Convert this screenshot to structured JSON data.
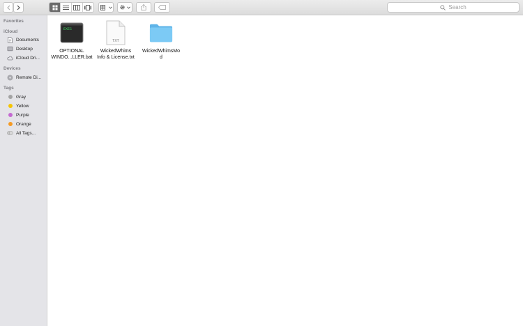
{
  "toolbar": {
    "search_placeholder": "Search"
  },
  "sidebar": {
    "sections": {
      "favorites": "Favorites",
      "icloud": "iCloud",
      "devices": "Devices",
      "tags": "Tags"
    },
    "icloud_items": [
      {
        "label": "Documents",
        "icon": "document-icon"
      },
      {
        "label": "Desktop",
        "icon": "desktop-icon"
      },
      {
        "label": "iCloud Dri...",
        "icon": "cloud-icon"
      }
    ],
    "device_items": [
      {
        "label": "Remote Di...",
        "icon": "disc-icon"
      }
    ],
    "tag_items": [
      {
        "label": "Gray",
        "color": "#a3a3a3"
      },
      {
        "label": "Yellow",
        "color": "#f5c400"
      },
      {
        "label": "Purple",
        "color": "#c46ad1"
      },
      {
        "label": "Orange",
        "color": "#f59a23"
      },
      {
        "label": "All Tags...",
        "color": "#c8c8c8"
      }
    ]
  },
  "files": [
    {
      "line1": "OPTIONAL",
      "line2": "WINDO...LLER.bat",
      "icon": "terminal-icon",
      "icon_text": "EXEC"
    },
    {
      "line1": "WickedWhims",
      "line2": "Info & License.txt",
      "icon": "text-file-icon",
      "icon_text": "TXT"
    },
    {
      "line1": "WickedWhimsMo",
      "line2": "d",
      "icon": "folder-icon"
    }
  ],
  "colors": {
    "sidebar_bg": "#e4e4e8",
    "folder": "#6fc3f3",
    "terminal_text": "#3ddc62"
  }
}
